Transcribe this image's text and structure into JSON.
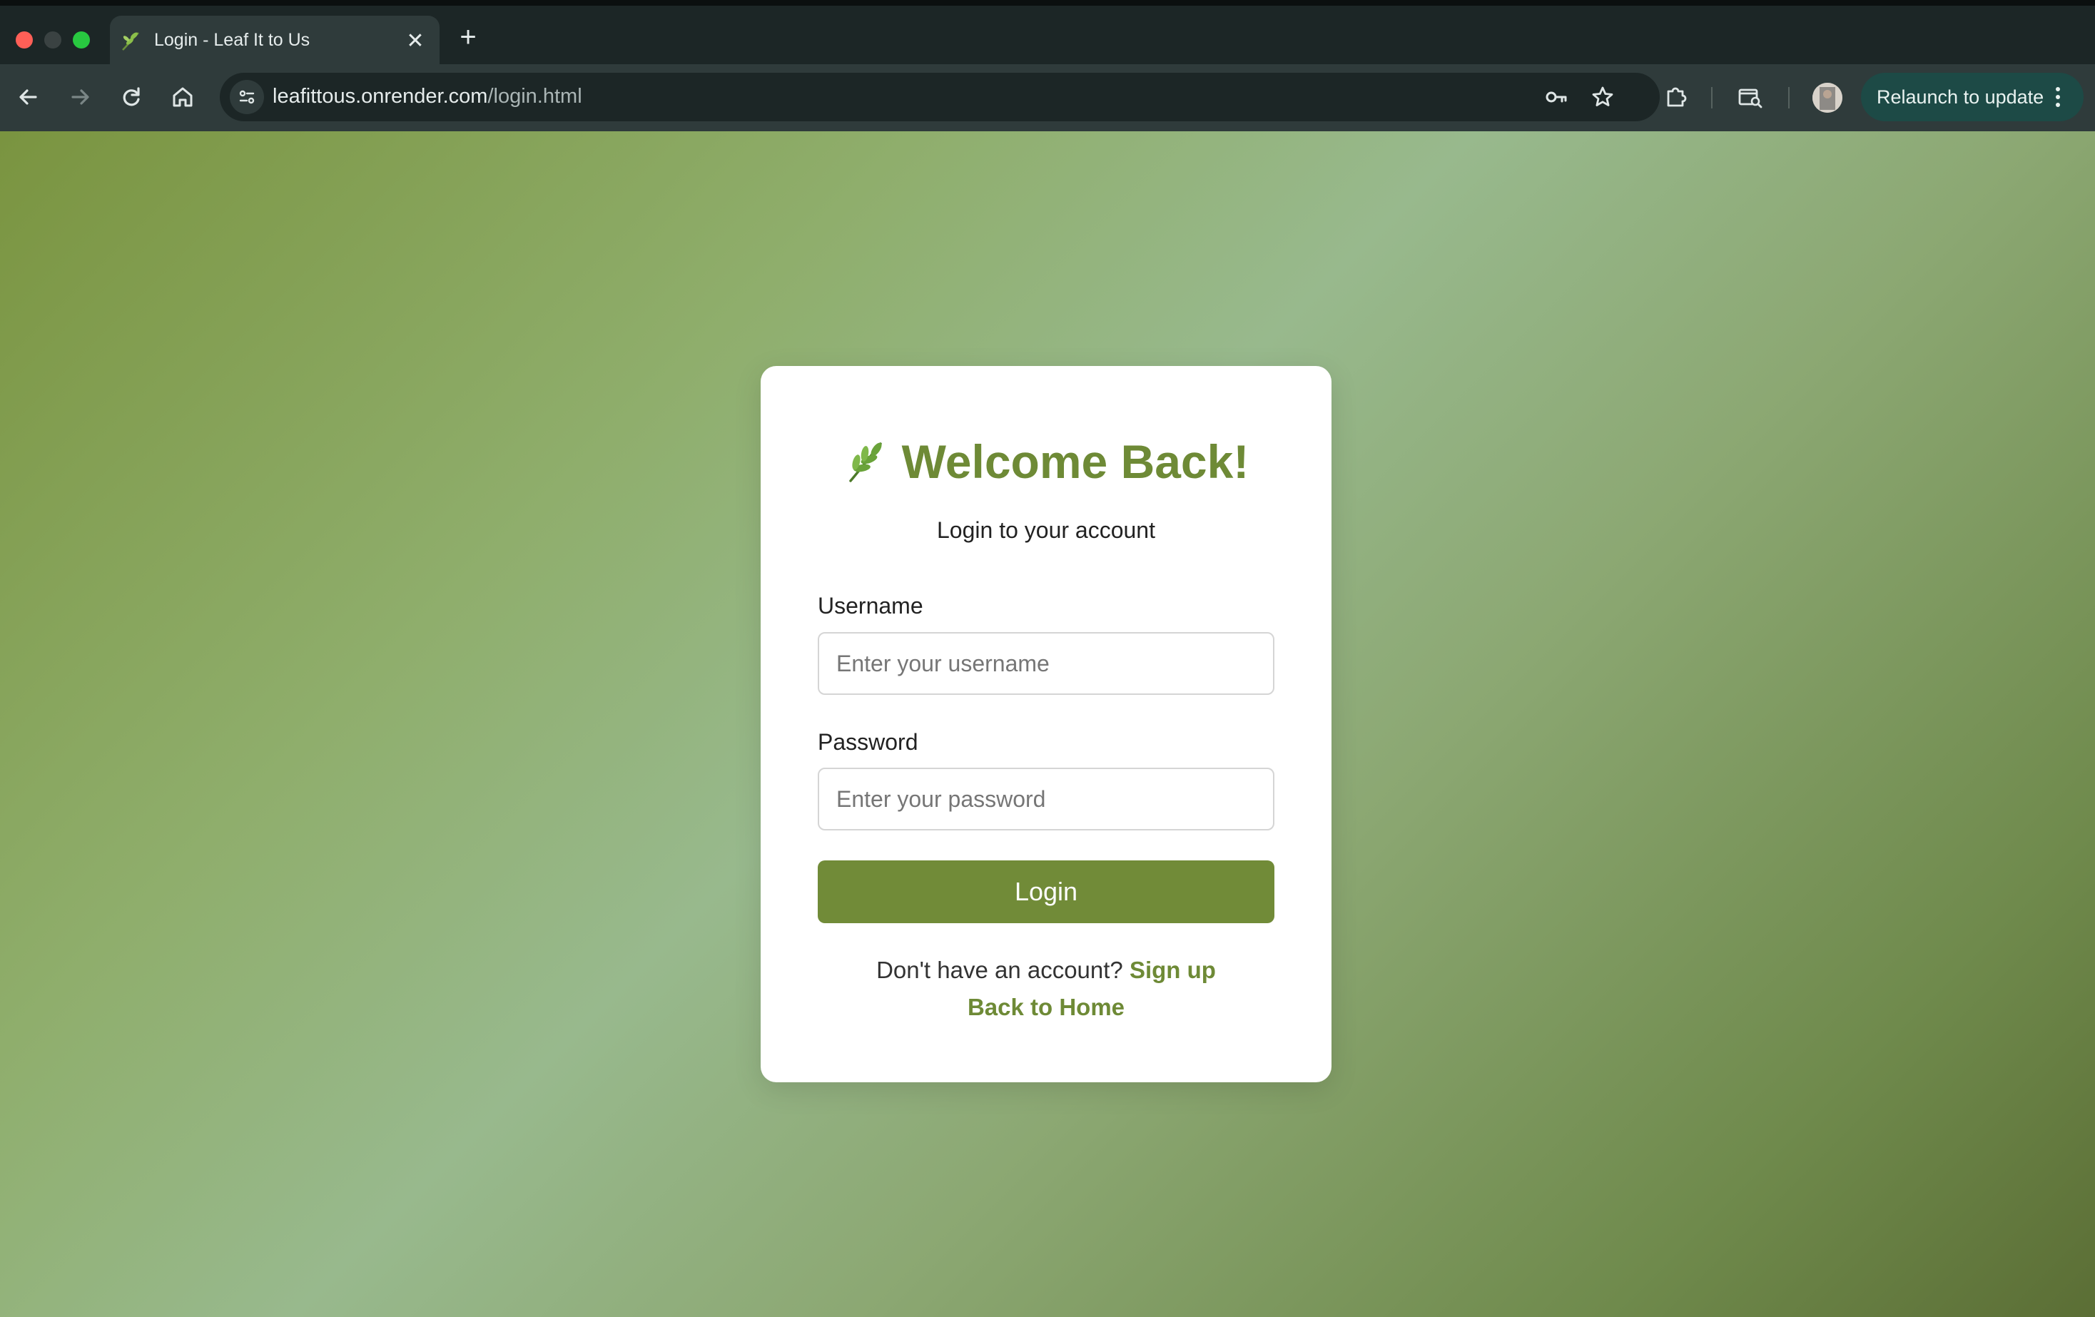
{
  "browser": {
    "tab_title": "Login - Leaf It to Us",
    "new_tab_symbol": "+",
    "close_symbol": "✕",
    "url_domain": "leafittous.onrender.com",
    "url_path": "/login.html",
    "relaunch_label": "Relaunch to update",
    "icons": [
      "back-icon",
      "forward-icon",
      "reload-icon",
      "home-icon",
      "site-settings-icon",
      "password-key-icon",
      "bookmark-star-icon",
      "extensions-icon",
      "tab-search-icon",
      "profile-avatar",
      "more-menu-icon"
    ]
  },
  "login": {
    "heading": "Welcome Back!",
    "subtitle": "Login to your account",
    "username_label": "Username",
    "username_placeholder": "Enter your username",
    "password_label": "Password",
    "password_placeholder": "Enter your password",
    "submit_label": "Login",
    "no_account_text": "Don't have an account?",
    "signup_link": "Sign up",
    "home_link": "Back to Home"
  },
  "colors": {
    "accent": "#718b38",
    "heading": "#6e8a36",
    "relaunch_bg": "#1d4a46"
  }
}
